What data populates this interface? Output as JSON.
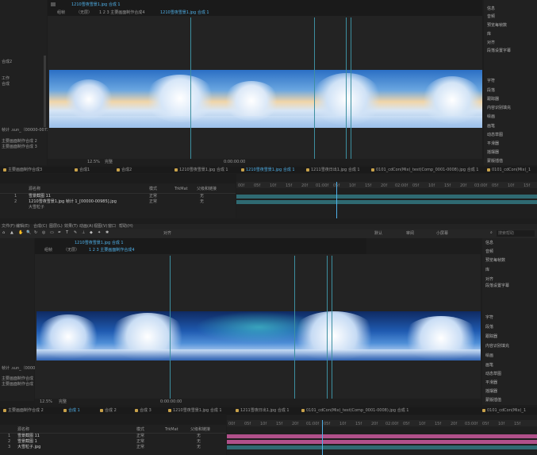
{
  "top": {
    "breadcrumbs": [
      "组帧",
      "（无层）",
      "1 2 3 主要画面制作合成4",
      "1210雪夜雪景1.jpg 合成 1"
    ],
    "comp_tab": "1210雪夜雪景1.jpg 合成 1",
    "left_labels": [
      "合成2",
      "工作",
      "合成"
    ],
    "left_file_label": "帧计 .sun_（00000-00735）",
    "left_list": [
      "主要画面制作合成 2",
      "主要画面制作合成 3"
    ],
    "zoom_value": "12.5%",
    "quality_value": "完整",
    "timecode": "0:00:00:00",
    "right_items": [
      "信息",
      "音频",
      "预览每帧数",
      "库",
      "对齐",
      "段落设置字幕",
      "字符",
      "段落",
      "跟踪器",
      "内容识别填充",
      "绘画",
      "画笔",
      "动态草图",
      "平滑器",
      "摇摆器",
      "蒙版插值"
    ],
    "timeline_tabs": [
      "主要画面制作合成3",
      "合成1",
      "合成2",
      "1210雪夜雪景1.jpg 合成 1",
      "1210雪夜雪景1.jpg 合成 1",
      "1211雪夜日出1.jpg 合成 1",
      "0101_cdCon(Mix)_test(Comp_0001-0008).jpg 合成 1",
      "0101_cdCon(Mix)_1"
    ],
    "timeline_columns": [
      "源名称",
      "模式",
      "TrkMat",
      "父级和链接"
    ],
    "layers": [
      {
        "num": "1",
        "name": "雪景截图 11",
        "mode": "正常",
        "parent": "无"
      },
      {
        "num": "2",
        "name": "1210雪夜雪景1.jpg 帧计 1_[00000-00985].jpg",
        "mode": "正常",
        "parent": "无"
      },
      {
        "num": "",
        "name": "大雪粒子",
        "mode": "",
        "parent": ""
      }
    ],
    "ticks": [
      "00f",
      "05f",
      "10f",
      "15f",
      "20f",
      "01:00f",
      "05f",
      "10f",
      "15f",
      "20f",
      "02:00f",
      "05f",
      "10f",
      "15f",
      "20f",
      "03:00f",
      "05f",
      "10f",
      "15f"
    ]
  },
  "menu": {
    "items": [
      "文件(F)",
      "编辑(E)",
      "合成(C)",
      "图层(L)",
      "效果(T)",
      "动画(A)",
      "视图(V)",
      "窗口",
      "帮助(H)"
    ],
    "snap_label": "对齐",
    "workspaces": [
      "默认",
      "审阅",
      "小屏幕"
    ],
    "search_placeholder": "搜索帮助"
  },
  "bottom": {
    "breadcrumbs": [
      "组帧",
      "（无层）",
      "1 2 3 主要画面制作合成4"
    ],
    "comp_tab": "1210雪夜雪景1.jpg 合成 1",
    "left_file_label": "帧计 .sun_（00000-00735）",
    "left_list": [
      "主要画面制作合成 2",
      "主要画面制作合成 3"
    ],
    "zoom_value": "12.5%",
    "quality_value": "完整",
    "timecode": "0:00:00:00",
    "right_items": [
      "信息",
      "音频",
      "预览每帧数",
      "库",
      "对齐",
      "段落设置字幕",
      "字符",
      "段落",
      "跟踪器",
      "内容识别填充",
      "绘画",
      "画笔",
      "动态草图",
      "平滑器",
      "摇摆器",
      "蒙版插值"
    ],
    "timeline_tabs": [
      "主要画面制作合成 2",
      "合成 1",
      "合成 2",
      "合成 3",
      "1210雪夜雪景1.jpg 合成 1",
      "1211雪夜日出1.jpg 合成 1",
      "0101_cdCon(Mix)_test(Comp_0001-0008).jpg 合成 1",
      "0101_cdCon(Mix)_1"
    ],
    "timeline_columns": [
      "源名称",
      "模式",
      "TrkMat",
      "父级和链接"
    ],
    "layers": [
      {
        "num": "1",
        "name": "雪景截图 11",
        "mode": "正常",
        "parent": "无"
      },
      {
        "num": "2",
        "name": "雪景截图 1",
        "mode": "正常",
        "parent": "无"
      },
      {
        "num": "3",
        "name": "大雪粒子.jpg",
        "mode": "正常",
        "parent": "无"
      }
    ],
    "ticks": [
      "00f",
      "05f",
      "10f",
      "15f",
      "20f",
      "01:00f",
      "05f",
      "10f",
      "15f",
      "20f",
      "02:00f",
      "05f",
      "10f",
      "15f",
      "20f",
      "03:00f",
      "05f",
      "10f",
      "15f"
    ]
  },
  "colors": {
    "accent": "#4fb0e8",
    "guide": "#3d8fa0",
    "track_top": "#2f6a72",
    "track_magenta": "#b0508a"
  }
}
